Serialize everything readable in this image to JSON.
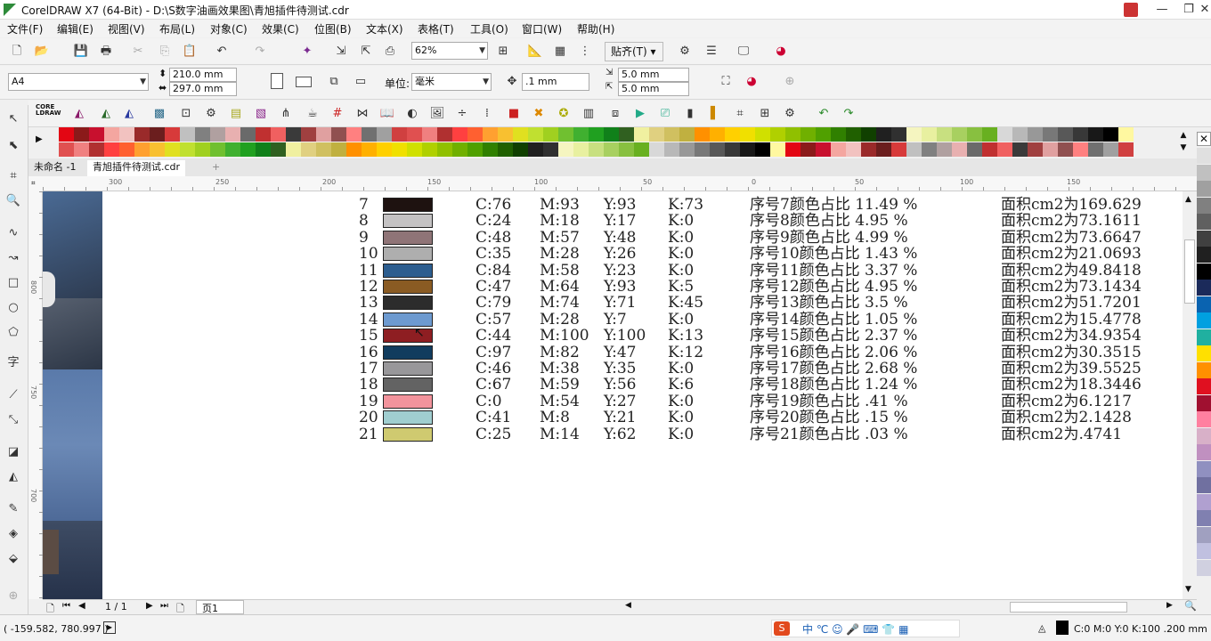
{
  "window": {
    "title": "CorelDRAW X7 (64-Bit) - D:\\S数字油画效果图\\青旭插件待测试.cdr",
    "minimize": "—",
    "restore": "❐",
    "close": "✕"
  },
  "menu": [
    "文件(F)",
    "编辑(E)",
    "视图(V)",
    "布局(L)",
    "对象(C)",
    "效果(C)",
    "位图(B)",
    "文本(X)",
    "表格(T)",
    "工具(O)",
    "窗口(W)",
    "帮助(H)"
  ],
  "toolbar": {
    "zoom": "62%",
    "snap": "贴齐(T)"
  },
  "propbar": {
    "page_size": "A4",
    "width": "210.0 mm",
    "height": "297.0 mm",
    "unit_label": "单位:",
    "unit": "毫米",
    "nudge": ".1 mm",
    "dup_x": "5.0 mm",
    "dup_y": "5.0 mm"
  },
  "tabs": [
    "未命名 -1",
    "青旭插件待测试.cdr"
  ],
  "rulers": {
    "h": [
      "300",
      "250",
      "200",
      "150",
      "100",
      "50",
      "0",
      "50",
      "100",
      "150"
    ],
    "v": [
      "800",
      "750",
      "700"
    ]
  },
  "table": {
    "rows": [
      {
        "n": "7",
        "color": "#1e1210",
        "c": "C:76",
        "m": "M:93",
        "y": "Y:93",
        "k": "K:73",
        "pct": "序号7颜色占比 11.49 %",
        "area": "面积cm2为169.629"
      },
      {
        "n": "8",
        "color": "#c4c2c3",
        "c": "C:24",
        "m": "M:18",
        "y": "Y:17",
        "k": "K:0",
        "pct": "序号8颜色占比 4.95 %",
        "area": "面积cm2为73.1611"
      },
      {
        "n": "9",
        "color": "#8f7477",
        "c": "C:48",
        "m": "M:57",
        "y": "Y:48",
        "k": "K:0",
        "pct": "序号9颜色占比 4.99 %",
        "area": "面积cm2为73.6647"
      },
      {
        "n": "10",
        "color": "#aeaeae",
        "c": "C:35",
        "m": "M:28",
        "y": "Y:26",
        "k": "K:0",
        "pct": "序号10颜色占比 1.43 %",
        "area": "面积cm2为21.0693"
      },
      {
        "n": "11",
        "color": "#2c5d8f",
        "c": "C:84",
        "m": "M:58",
        "y": "Y:23",
        "k": "K:0",
        "pct": "序号11颜色占比 3.37 %",
        "area": "面积cm2为49.8418"
      },
      {
        "n": "12",
        "color": "#8a5b23",
        "c": "C:47",
        "m": "M:64",
        "y": "Y:93",
        "k": "K:5",
        "pct": "序号12颜色占比 4.95 %",
        "area": "面积cm2为73.1434"
      },
      {
        "n": "13",
        "color": "#2c2c2c",
        "c": "C:79",
        "m": "M:74",
        "y": "Y:71",
        "k": "K:45",
        "pct": "序号13颜色占比 3.5 %",
        "area": "面积cm2为51.7201"
      },
      {
        "n": "14",
        "color": "#6d9ad0",
        "c": "C:57",
        "m": "M:28",
        "y": "Y:7",
        "k": "K:0",
        "pct": "序号14颜色占比 1.05 %",
        "area": "面积cm2为15.4778"
      },
      {
        "n": "15",
        "color": "#8e1e22",
        "c": "C:44",
        "m": "M:100",
        "y": "Y:100",
        "k": "K:13",
        "pct": "序号15颜色占比 2.37 %",
        "area": "面积cm2为34.9354"
      },
      {
        "n": "16",
        "color": "#113c5e",
        "c": "C:97",
        "m": "M:82",
        "y": "Y:47",
        "k": "K:12",
        "pct": "序号16颜色占比 2.06 %",
        "area": "面积cm2为30.3515"
      },
      {
        "n": "17",
        "color": "#98979a",
        "c": "C:46",
        "m": "M:38",
        "y": "Y:35",
        "k": "K:0",
        "pct": "序号17颜色占比 2.68 %",
        "area": "面积cm2为39.5525"
      },
      {
        "n": "18",
        "color": "#636363",
        "c": "C:67",
        "m": "M:59",
        "y": "Y:56",
        "k": "K:6",
        "pct": "序号18颜色占比 1.24 %",
        "area": "面积cm2为18.3446"
      },
      {
        "n": "19",
        "color": "#f2939c",
        "c": "C:0",
        "m": "M:54",
        "y": "Y:27",
        "k": "K:0",
        "pct": "序号19颜色占比 .41 %",
        "area": "面积cm2为6.1217"
      },
      {
        "n": "20",
        "color": "#a0ced0",
        "c": "C:41",
        "m": "M:8",
        "y": "Y:21",
        "k": "K:0",
        "pct": "序号20颜色占比 .15 %",
        "area": "面积cm2为2.1428"
      },
      {
        "n": "21",
        "color": "#cfca70",
        "c": "C:25",
        "m": "M:14",
        "y": "Y:62",
        "k": "K:0",
        "pct": "序号21颜色占比 .03 %",
        "area": "面积cm2为.4741"
      }
    ]
  },
  "pager": {
    "page_count": "1 / 1",
    "page_tab": "页1"
  },
  "status": {
    "coords": "( -159.582, 780.997 )",
    "fill_info": "C:0 M:0 Y:0 K:100 .200 mm"
  },
  "palette_colors": [
    "#e0e0e0",
    "#c0c0c0",
    "#a0a0a0",
    "#808080",
    "#606060",
    "#404040",
    "#202020",
    "#000000",
    "#1b2a5a",
    "#0a63b0",
    "#00a0e0",
    "#20b0a0",
    "#ffe000",
    "#ff9000",
    "#e01020",
    "#a01030",
    "#ff80a0",
    "#d8b0c8",
    "#c090c0",
    "#9090c0",
    "#7070a0",
    "#b0a0d0",
    "#8080b0",
    "#a0a0c0",
    "#c0c0e0",
    "#d0d0e0"
  ],
  "theme": {
    "accent": "#3a78c8"
  }
}
